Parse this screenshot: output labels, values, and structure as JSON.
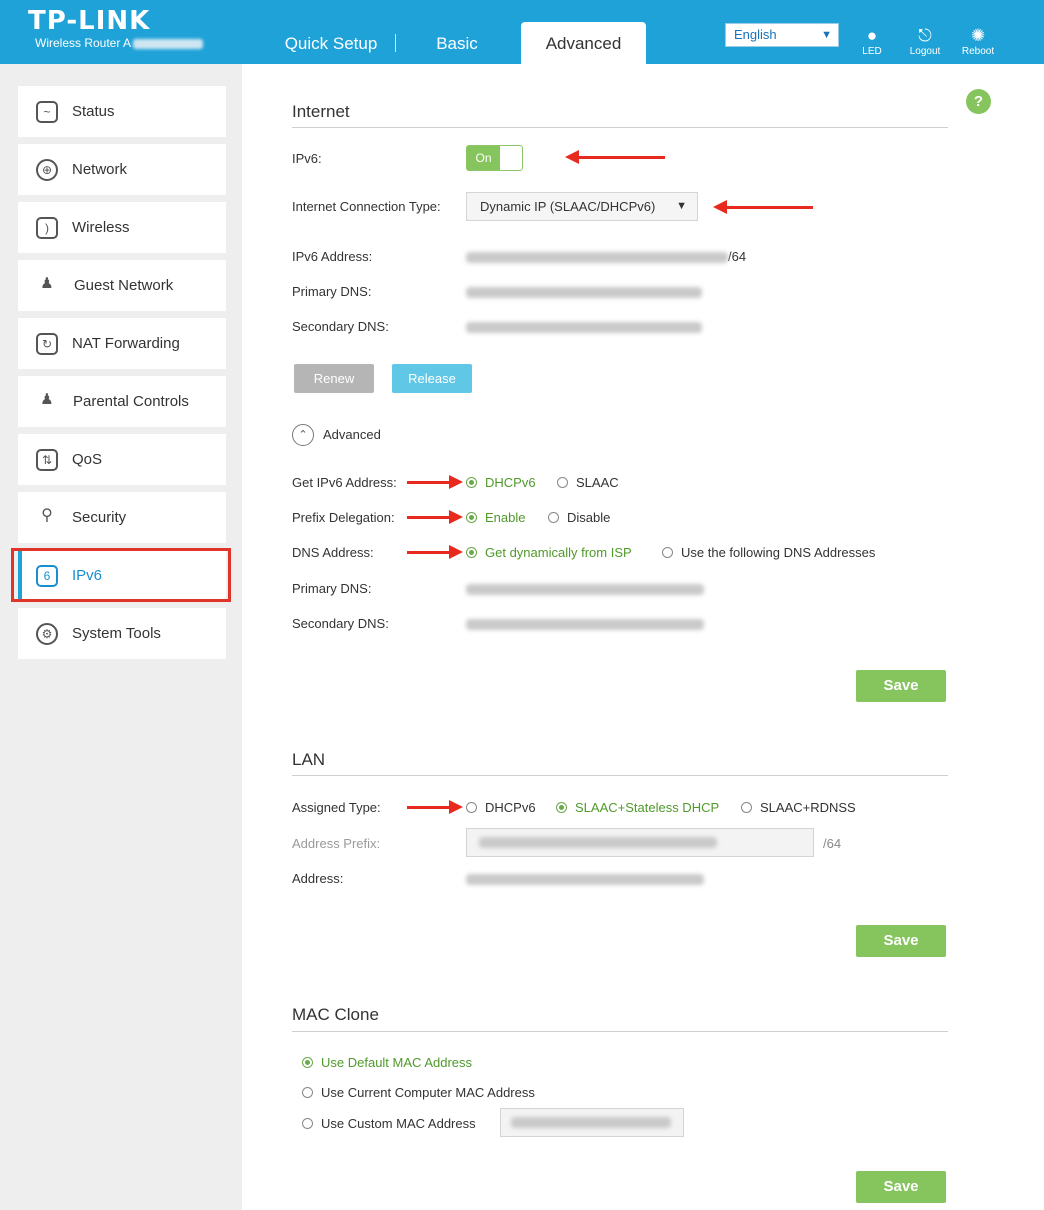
{
  "header": {
    "logo": "TP-LINK",
    "subtitle": "Wireless Router A",
    "tabs": {
      "quick_setup": "Quick Setup",
      "basic": "Basic",
      "advanced": "Advanced"
    },
    "language": "English",
    "icons": {
      "led": "LED",
      "logout": "Logout",
      "reboot": "Reboot"
    }
  },
  "sidebar": {
    "items": [
      {
        "label": "Status",
        "icon": "status-icon"
      },
      {
        "label": "Network",
        "icon": "globe-icon"
      },
      {
        "label": "Wireless",
        "icon": "wifi-icon"
      },
      {
        "label": "Guest Network",
        "icon": "guest-icon"
      },
      {
        "label": "NAT Forwarding",
        "icon": "nat-icon"
      },
      {
        "label": "Parental Controls",
        "icon": "parental-icon"
      },
      {
        "label": "QoS",
        "icon": "qos-icon"
      },
      {
        "label": "Security",
        "icon": "lock-icon"
      },
      {
        "label": "IPv6",
        "icon": "ipv6-icon"
      },
      {
        "label": "System Tools",
        "icon": "gear-icon"
      }
    ],
    "active": "IPv6"
  },
  "internet": {
    "title": "Internet",
    "ipv6_label": "IPv6:",
    "ipv6_toggle": "On",
    "conn_type_label": "Internet Connection Type:",
    "conn_type_value": "Dynamic IP (SLAAC/DHCPv6)",
    "ipv6_address_label": "IPv6 Address:",
    "ipv6_address_suffix": "/64",
    "primary_dns_label": "Primary DNS:",
    "secondary_dns_label": "Secondary DNS:",
    "renew": "Renew",
    "release": "Release",
    "advanced_label": "Advanced",
    "get_ipv6_label": "Get IPv6 Address:",
    "get_ipv6_options": [
      "DHCPv6",
      "SLAAC"
    ],
    "prefix_label": "Prefix Delegation:",
    "prefix_options": [
      "Enable",
      "Disable"
    ],
    "dns_address_label": "DNS Address:",
    "dns_options": [
      "Get dynamically from ISP",
      "Use the following DNS Addresses"
    ],
    "adv_primary_dns_label": "Primary DNS:",
    "adv_secondary_dns_label": "Secondary DNS:",
    "save": "Save"
  },
  "lan": {
    "title": "LAN",
    "assigned_label": "Assigned Type:",
    "assigned_options": [
      "DHCPv6",
      "SLAAC+Stateless DHCP",
      "SLAAC+RDNSS"
    ],
    "prefix_label": "Address Prefix:",
    "prefix_suffix": "/64",
    "address_label": "Address:",
    "save": "Save"
  },
  "mac_clone": {
    "title": "MAC Clone",
    "options": [
      "Use Default MAC Address",
      "Use Current Computer MAC Address",
      "Use Custom MAC Address"
    ],
    "save": "Save"
  },
  "help": "?",
  "colors": {
    "header": "#1fa2d8",
    "accent_green": "#86c45e",
    "annotation_red": "#e8291e"
  }
}
